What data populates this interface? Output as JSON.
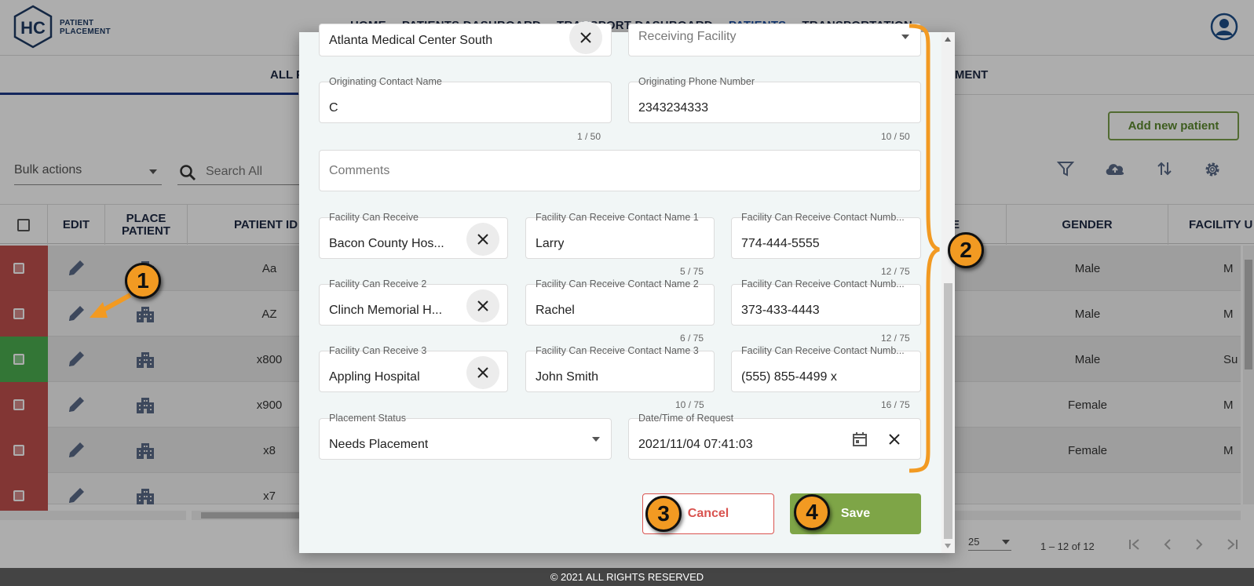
{
  "app": {
    "logo_mark": "HC",
    "logo_line1": "PATIENT",
    "logo_line2": "PLACEMENT"
  },
  "nav": {
    "items": [
      {
        "label": "HOME"
      },
      {
        "label": "PATIENTS DASHBOARD"
      },
      {
        "label": "TRANSPORT DASHBOARD"
      },
      {
        "label": "PATIENTS",
        "active": true
      },
      {
        "label": "TRANSPORTATION"
      }
    ]
  },
  "tabs": {
    "all_label": "ALL P",
    "placement_label": "CEMENT"
  },
  "toolbar": {
    "add_patient_label": "Add new patient",
    "bulk_actions_label": "Bulk actions",
    "search_placeholder": "Search All",
    "icons": [
      "filter-icon",
      "cloud-upload-icon",
      "sort-icon",
      "settings-icon"
    ]
  },
  "table": {
    "headers": {
      "edit": "EDIT",
      "place": "PLACE PATIENT",
      "patient_id": "PATIENT ID",
      "col_e": "E",
      "gender": "GENDER",
      "facility": "FACILITY U"
    },
    "rows": [
      {
        "status_color": "#c0504d",
        "patient_id": "Aa",
        "gender": "Male",
        "facility": "M"
      },
      {
        "status_color": "#c0504d",
        "patient_id": "AZ",
        "gender": "Male",
        "facility": "M"
      },
      {
        "status_color": "#4caf50",
        "patient_id": "x800",
        "gender": "Male",
        "facility": "Su"
      },
      {
        "status_color": "#c0504d",
        "patient_id": "x900",
        "gender": "Female",
        "facility": "M"
      },
      {
        "status_color": "#c0504d",
        "patient_id": "x8",
        "gender": "Female",
        "facility": "M"
      },
      {
        "status_color": "#c0504d",
        "patient_id": "x7",
        "gender": "",
        "facility": ""
      }
    ]
  },
  "pager": {
    "page_size": "25",
    "range": "1 – 12 of 12"
  },
  "footer": {
    "text": "© 2021 ALL RIGHTS RESERVED"
  },
  "modal": {
    "originating_facility_value": "Atlanta Medical Center South",
    "receiving_facility_placeholder": "Receiving Facility",
    "originating_contact_label": "Originating Contact Name",
    "originating_contact_value": "C",
    "originating_contact_counter": "1 / 50",
    "originating_phone_label": "Originating Phone Number",
    "originating_phone_value": "2343234333",
    "originating_phone_counter": "10 / 50",
    "comments_placeholder": "Comments",
    "can_receive": [
      {
        "facility_label": "Facility Can Receive",
        "facility_value": "Bacon County Hos...",
        "contact_label": "Facility Can Receive Contact Name 1",
        "contact_value": "Larry",
        "contact_counter": "5 / 75",
        "number_label": "Facility Can Receive Contact Numb...",
        "number_value": "774-444-5555",
        "number_counter": "12 / 75"
      },
      {
        "facility_label": "Facility Can Receive 2",
        "facility_value": "Clinch Memorial H...",
        "contact_label": "Facility Can Receive Contact Name 2",
        "contact_value": "Rachel",
        "contact_counter": "6 / 75",
        "number_label": "Facility Can Receive Contact Numb...",
        "number_value": "373-433-4443",
        "number_counter": "12 / 75"
      },
      {
        "facility_label": "Facility Can Receive 3",
        "facility_value": "Appling Hospital",
        "contact_label": "Facility Can Receive Contact Name 3",
        "contact_value": "John Smith",
        "contact_counter": "10 / 75",
        "number_label": "Facility Can Receive Contact Numb...",
        "number_value": "(555) 855-4499 x",
        "number_counter": "16 / 75"
      }
    ],
    "placement_status_label": "Placement Status",
    "placement_status_value": "Needs Placement",
    "request_datetime_label": "Date/Time of Request",
    "request_datetime_value": "2021/11/04 07:41:03",
    "cancel_label": "Cancel",
    "save_label": "Save"
  },
  "annotations": {
    "badge_1": "1",
    "badge_2": "2",
    "badge_3": "3",
    "badge_4": "4",
    "color": "#f29a22"
  }
}
